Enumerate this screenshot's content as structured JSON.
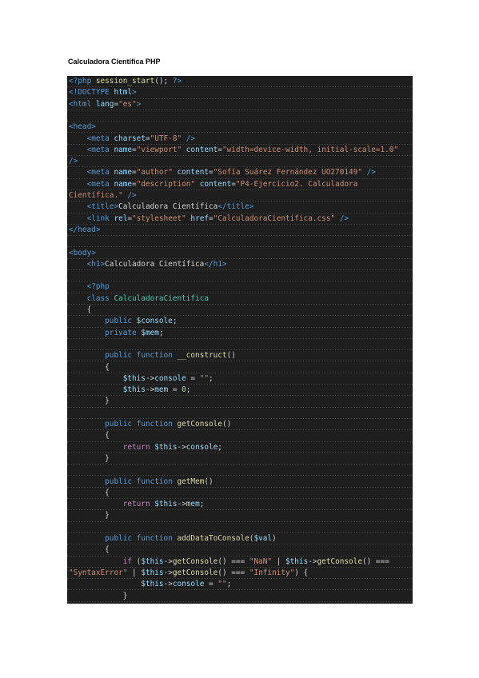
{
  "document": {
    "title": "Calculadora Científica PHP"
  },
  "colors": {
    "background": "#1e1e1e",
    "tag": "#569cd6",
    "attribute": "#9cdcfe",
    "string": "#ce9178",
    "keyword": "#569cd6",
    "control": "#c586c0",
    "function": "#dcdcaa",
    "variable": "#9cdcfe",
    "class": "#4ec9b0",
    "plain": "#d4d4d4",
    "number": "#b5cea8"
  },
  "code": {
    "lines": [
      [
        {
          "t": "<?php ",
          "c": "tag"
        },
        {
          "t": "session_start",
          "c": "function"
        },
        {
          "t": "(); ",
          "c": "plain"
        },
        {
          "t": "?>",
          "c": "tag"
        }
      ],
      [
        {
          "t": "<!DOCTYPE ",
          "c": "tag"
        },
        {
          "t": "html",
          "c": "attribute"
        },
        {
          "t": ">",
          "c": "tag"
        }
      ],
      [
        {
          "t": "<html ",
          "c": "tag"
        },
        {
          "t": "lang",
          "c": "attribute"
        },
        {
          "t": "=",
          "c": "plain"
        },
        {
          "t": "\"es\"",
          "c": "string"
        },
        {
          "t": ">",
          "c": "tag"
        }
      ],
      [],
      [
        {
          "t": "<head>",
          "c": "tag"
        }
      ],
      [
        {
          "t": "    <meta ",
          "c": "tag"
        },
        {
          "t": "charset",
          "c": "attribute"
        },
        {
          "t": "=",
          "c": "plain"
        },
        {
          "t": "\"UTF-8\"",
          "c": "string"
        },
        {
          "t": " />",
          "c": "tag"
        }
      ],
      [
        {
          "t": "    <meta ",
          "c": "tag"
        },
        {
          "t": "name",
          "c": "attribute"
        },
        {
          "t": "=",
          "c": "plain"
        },
        {
          "t": "\"viewport\"",
          "c": "string"
        },
        {
          "t": " content",
          "c": "attribute"
        },
        {
          "t": "=",
          "c": "plain"
        },
        {
          "t": "\"width=device-width, initial-scale=1.0\"",
          "c": "string"
        }
      ],
      [
        {
          "t": "/>",
          "c": "tag"
        }
      ],
      [
        {
          "t": "    <meta ",
          "c": "tag"
        },
        {
          "t": "name",
          "c": "attribute"
        },
        {
          "t": "=",
          "c": "plain"
        },
        {
          "t": "\"author\"",
          "c": "string"
        },
        {
          "t": " content",
          "c": "attribute"
        },
        {
          "t": "=",
          "c": "plain"
        },
        {
          "t": "\"Sofía Suárez Fernández UO270149\"",
          "c": "string"
        },
        {
          "t": " />",
          "c": "tag"
        }
      ],
      [
        {
          "t": "    <meta ",
          "c": "tag"
        },
        {
          "t": "name",
          "c": "attribute"
        },
        {
          "t": "=",
          "c": "plain"
        },
        {
          "t": "\"description\"",
          "c": "string"
        },
        {
          "t": " content",
          "c": "attribute"
        },
        {
          "t": "=",
          "c": "plain"
        },
        {
          "t": "\"P4-Ejercicio2. Calculadora",
          "c": "string"
        }
      ],
      [
        {
          "t": "Científica.\"",
          "c": "string"
        },
        {
          "t": " />",
          "c": "tag"
        }
      ],
      [
        {
          "t": "    <title>",
          "c": "tag"
        },
        {
          "t": "Calculadora Científica",
          "c": "plain"
        },
        {
          "t": "</title>",
          "c": "tag"
        }
      ],
      [
        {
          "t": "    <link ",
          "c": "tag"
        },
        {
          "t": "rel",
          "c": "attribute"
        },
        {
          "t": "=",
          "c": "plain"
        },
        {
          "t": "\"stylesheet\"",
          "c": "string"
        },
        {
          "t": " href",
          "c": "attribute"
        },
        {
          "t": "=",
          "c": "plain"
        },
        {
          "t": "\"CalculadoraCientifica.css\"",
          "c": "string"
        },
        {
          "t": " />",
          "c": "tag"
        }
      ],
      [
        {
          "t": "</head>",
          "c": "tag"
        }
      ],
      [],
      [
        {
          "t": "<body>",
          "c": "tag"
        }
      ],
      [
        {
          "t": "    <h1>",
          "c": "tag"
        },
        {
          "t": "Calculadora Científica",
          "c": "plain"
        },
        {
          "t": "</h1>",
          "c": "tag"
        }
      ],
      [],
      [
        {
          "t": "    <?php",
          "c": "tag"
        }
      ],
      [
        {
          "t": "    class ",
          "c": "keyword"
        },
        {
          "t": "CalculadoraCientifica",
          "c": "class"
        }
      ],
      [
        {
          "t": "    {",
          "c": "plain"
        }
      ],
      [
        {
          "t": "        public ",
          "c": "keyword"
        },
        {
          "t": "$console",
          "c": "variable"
        },
        {
          "t": ";",
          "c": "plain"
        }
      ],
      [
        {
          "t": "        private ",
          "c": "keyword"
        },
        {
          "t": "$mem",
          "c": "variable"
        },
        {
          "t": ";",
          "c": "plain"
        }
      ],
      [],
      [
        {
          "t": "        public ",
          "c": "keyword"
        },
        {
          "t": "function ",
          "c": "keyword"
        },
        {
          "t": "__construct",
          "c": "function"
        },
        {
          "t": "()",
          "c": "plain"
        }
      ],
      [
        {
          "t": "        {",
          "c": "plain"
        }
      ],
      [
        {
          "t": "            $this",
          "c": "variable"
        },
        {
          "t": "->",
          "c": "plain"
        },
        {
          "t": "console",
          "c": "variable"
        },
        {
          "t": " = ",
          "c": "plain"
        },
        {
          "t": "\"\"",
          "c": "string"
        },
        {
          "t": ";",
          "c": "plain"
        }
      ],
      [
        {
          "t": "            $this",
          "c": "variable"
        },
        {
          "t": "->",
          "c": "plain"
        },
        {
          "t": "mem",
          "c": "variable"
        },
        {
          "t": " = ",
          "c": "plain"
        },
        {
          "t": "0",
          "c": "number"
        },
        {
          "t": ";",
          "c": "plain"
        }
      ],
      [
        {
          "t": "        }",
          "c": "plain"
        }
      ],
      [],
      [
        {
          "t": "        public ",
          "c": "keyword"
        },
        {
          "t": "function ",
          "c": "keyword"
        },
        {
          "t": "getConsole",
          "c": "function"
        },
        {
          "t": "()",
          "c": "plain"
        }
      ],
      [
        {
          "t": "        {",
          "c": "plain"
        }
      ],
      [
        {
          "t": "            return ",
          "c": "control"
        },
        {
          "t": "$this",
          "c": "variable"
        },
        {
          "t": "->",
          "c": "plain"
        },
        {
          "t": "console",
          "c": "variable"
        },
        {
          "t": ";",
          "c": "plain"
        }
      ],
      [
        {
          "t": "        }",
          "c": "plain"
        }
      ],
      [],
      [
        {
          "t": "        public ",
          "c": "keyword"
        },
        {
          "t": "function ",
          "c": "keyword"
        },
        {
          "t": "getMem",
          "c": "function"
        },
        {
          "t": "()",
          "c": "plain"
        }
      ],
      [
        {
          "t": "        {",
          "c": "plain"
        }
      ],
      [
        {
          "t": "            return ",
          "c": "control"
        },
        {
          "t": "$this",
          "c": "variable"
        },
        {
          "t": "->",
          "c": "plain"
        },
        {
          "t": "mem",
          "c": "variable"
        },
        {
          "t": ";",
          "c": "plain"
        }
      ],
      [
        {
          "t": "        }",
          "c": "plain"
        }
      ],
      [],
      [
        {
          "t": "        public ",
          "c": "keyword"
        },
        {
          "t": "function ",
          "c": "keyword"
        },
        {
          "t": "addDataToConsole",
          "c": "function"
        },
        {
          "t": "(",
          "c": "plain"
        },
        {
          "t": "$val",
          "c": "variable"
        },
        {
          "t": ")",
          "c": "plain"
        }
      ],
      [
        {
          "t": "        {",
          "c": "plain"
        }
      ],
      [
        {
          "t": "            if ",
          "c": "control"
        },
        {
          "t": "(",
          "c": "plain"
        },
        {
          "t": "$this",
          "c": "variable"
        },
        {
          "t": "->",
          "c": "plain"
        },
        {
          "t": "getConsole",
          "c": "function"
        },
        {
          "t": "() === ",
          "c": "plain"
        },
        {
          "t": "\"NaN\"",
          "c": "string"
        },
        {
          "t": " | ",
          "c": "plain"
        },
        {
          "t": "$this",
          "c": "variable"
        },
        {
          "t": "->",
          "c": "plain"
        },
        {
          "t": "getConsole",
          "c": "function"
        },
        {
          "t": "() ===",
          "c": "plain"
        }
      ],
      [
        {
          "t": "\"SyntaxError\"",
          "c": "string"
        },
        {
          "t": " | ",
          "c": "plain"
        },
        {
          "t": "$this",
          "c": "variable"
        },
        {
          "t": "->",
          "c": "plain"
        },
        {
          "t": "getConsole",
          "c": "function"
        },
        {
          "t": "() === ",
          "c": "plain"
        },
        {
          "t": "\"Infinity\"",
          "c": "string"
        },
        {
          "t": ") {",
          "c": "plain"
        }
      ],
      [
        {
          "t": "                $this",
          "c": "variable"
        },
        {
          "t": "->",
          "c": "plain"
        },
        {
          "t": "console",
          "c": "variable"
        },
        {
          "t": " = ",
          "c": "plain"
        },
        {
          "t": "\"\"",
          "c": "string"
        },
        {
          "t": ";",
          "c": "plain"
        }
      ],
      [
        {
          "t": "            }",
          "c": "plain"
        }
      ]
    ]
  }
}
